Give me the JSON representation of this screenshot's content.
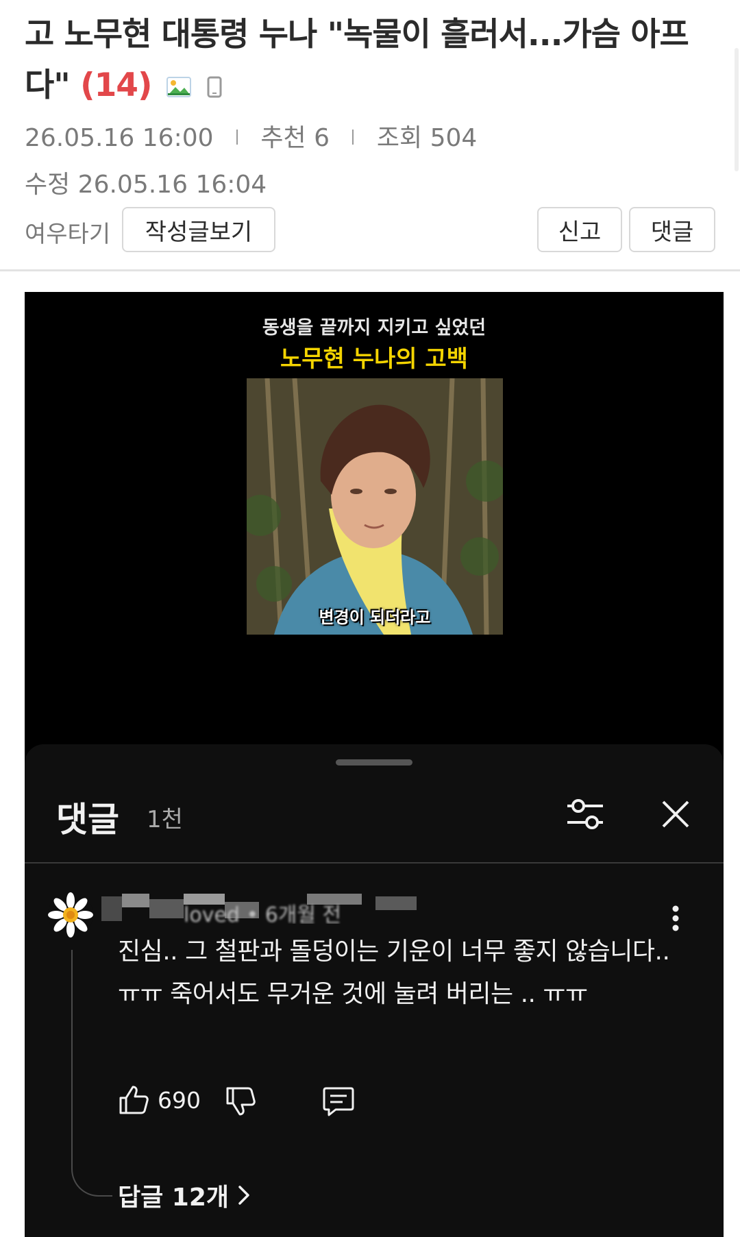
{
  "post": {
    "title": "고 노무현 대통령 누나 \"녹물이 흘러서...가슴 아프다\"",
    "comment_count": "(14)",
    "date": "26.05.16  16:00",
    "recommend": "추천 6",
    "views": "조회 504",
    "edited": "수정 26.05.16  16:04",
    "author": "여우타기",
    "buttons": {
      "view_posts": "작성글보기",
      "report": "신고",
      "comment": "댓글"
    }
  },
  "video": {
    "caption_top": "동생을 끝까지 지키고 싶었던",
    "caption_main": "노무현 누나의 고백",
    "subtitle": "변경이 되더라고"
  },
  "comments_sheet": {
    "title": "댓글",
    "count": "1천",
    "comment": {
      "author_partial": "loved • 6개월 전",
      "text": "진심.. 그 철판과 돌덩이는 기운이 너무 좋지 않습니다..ㅠㅠ 죽어서도 무거운 것에 눌려 버리는 .. ㅠㅠ",
      "likes": "690",
      "replies": "답글 12개"
    }
  },
  "colors": {
    "count_red": "#e2474a",
    "caption_yellow": "#f4d400",
    "sheet_bg": "#0f0f0f"
  }
}
